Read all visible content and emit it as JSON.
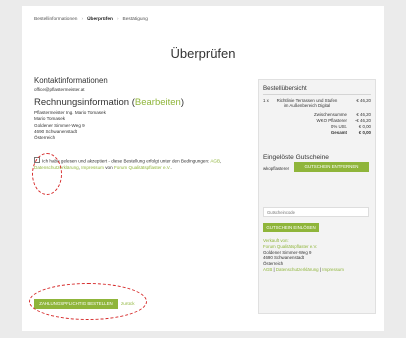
{
  "breadcrumb": {
    "step1": "Bestellinformationen",
    "step2": "Überprüfen",
    "step3": "Bestätigung",
    "separator": "›"
  },
  "page_title": "Überprüfen",
  "contact": {
    "heading": "Kontaktinformationen",
    "email": "office@pflastermeister.at"
  },
  "billing": {
    "heading": "Rechnungsinformation",
    "edit_link": "Bearbeiten",
    "lines": [
      "Pflastermeister Ing. Mario Tomasek",
      "Mario Tomasek",
      "Goldener Simmer-Weg 9",
      "4690 Schwanenstadt",
      "Österreich"
    ]
  },
  "terms": {
    "text": "Ich habe gelesen und akzeptiert - diese Bestellung erfolgt unter den Bedingungen:",
    "link_agb": "AGB",
    "link_privacy": "Datenschutzerklärung",
    "link_imprint": "Impressum",
    "from_word": "von",
    "link_vendor": "Forum Qualitätspflaster e.V."
  },
  "summary": {
    "heading": "Bestellübersicht",
    "item": {
      "qty": "1 x",
      "name": "Richtlinie Terrassen und Stufen im Außenbereich Digital",
      "price": "€ 46,20"
    },
    "totals": [
      {
        "label": "Zwischensumme",
        "value": "€ 46,20"
      },
      {
        "label": "WKO Pflasterer",
        "value": "-€ 46,20"
      },
      {
        "label": "0% USt.",
        "value": "€ 0,00"
      },
      {
        "label": "Gesamt",
        "value": "€ 0,00"
      }
    ]
  },
  "coupons": {
    "heading": "Eingelöste Gutscheine",
    "code": "wkopflasterer",
    "remove_label": "Gutschein entfernen",
    "input_placeholder": "Gutscheincode",
    "redeem_label": "Gutschein einlösen"
  },
  "seller": {
    "sold_by": "Verkauft von:",
    "name": "Forum Qualitätspflaster e.V.",
    "lines": [
      "Goldener Simmer-Weg 9",
      "4690 Schwanenstadt",
      "Österreich"
    ],
    "link_agb": "AGB",
    "link_privacy": "Datenschutzerklärung",
    "link_imprint": "Impressum",
    "separator": "|"
  },
  "order": {
    "button_label": "Zahlungspflichtig bestellen",
    "back_label": "zurück"
  },
  "colors": {
    "accent": "#8fb53a",
    "annotation": "#d62b2b"
  }
}
